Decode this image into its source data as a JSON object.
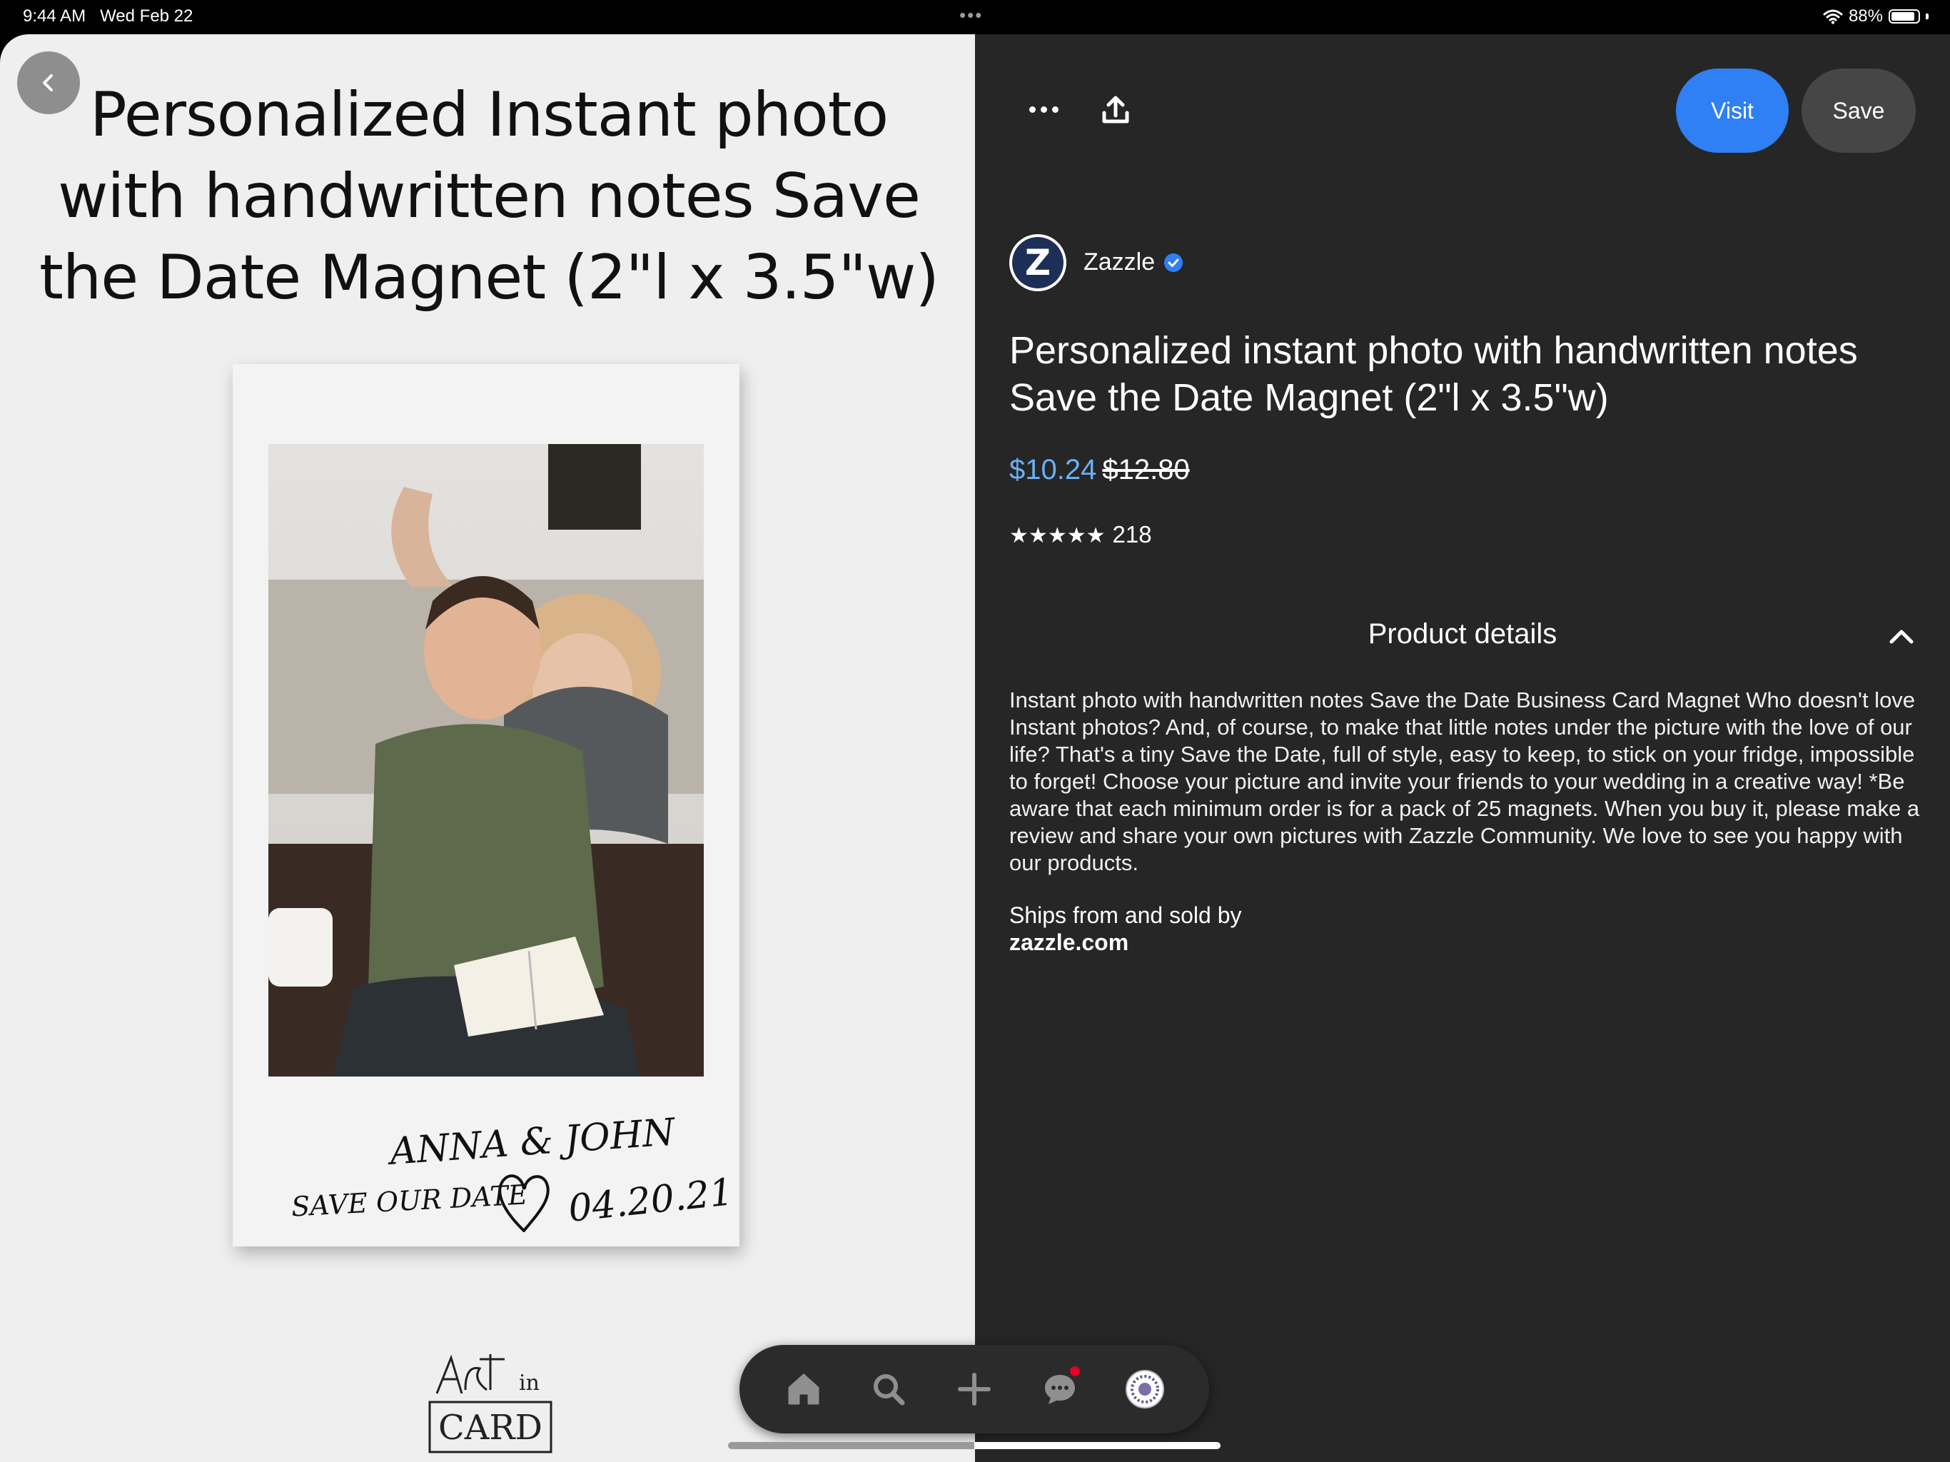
{
  "status_bar": {
    "time": "9:44 AM",
    "date": "Wed Feb 22",
    "battery_text": "88%",
    "battery_level": 0.88
  },
  "pin_image": {
    "heading": "Personalized Instant photo with handwritten notes Save the Date Magnet (2\"l x 3.5\"w)",
    "handwriting_names": "ANNA & JOHN",
    "handwriting_save": "SAVE OUR DATE",
    "handwriting_date": "04.20.21",
    "brand_mark_text": "ART in CARD"
  },
  "actions": {
    "visit_label": "Visit",
    "save_label": "Save"
  },
  "seller": {
    "name": "Zazzle",
    "avatar_letter": "Z",
    "verified": true
  },
  "product": {
    "title": "Personalized instant photo with handwritten notes Save the Date Magnet (2\"l x 3.5\"w)",
    "price_current": "$10.24",
    "price_original": "$12.80",
    "rating_stars": 5,
    "rating_count": "218"
  },
  "details": {
    "header": "Product details",
    "description": "Instant photo with handwritten notes Save the Date Business Card Magnet Who doesn't love Instant photos? And, of course, to make that little notes under the picture with the love of our life? That's a tiny Save the Date, full of style, easy to keep, to stick on your fridge, impossible to forget! Choose your picture and invite your friends to your wedding in a creative way! *Be aware that each minimum order is for a pack of 25 magnets. When you buy it, please make a review and share your own pictures with Zazzle Community. We love to see you happy with our products.",
    "ships_label": "Ships from and sold by",
    "ships_seller": "zazzle.com"
  },
  "nav": {
    "items": [
      "home-icon",
      "search-icon",
      "create-icon",
      "messages-icon",
      "profile-avatar"
    ],
    "messages_has_notification": true
  },
  "colors": {
    "accent_blue": "#2f7ff5",
    "price_blue": "#6ab0f5",
    "notification_red": "#e60023",
    "panel_dark": "#262626"
  }
}
